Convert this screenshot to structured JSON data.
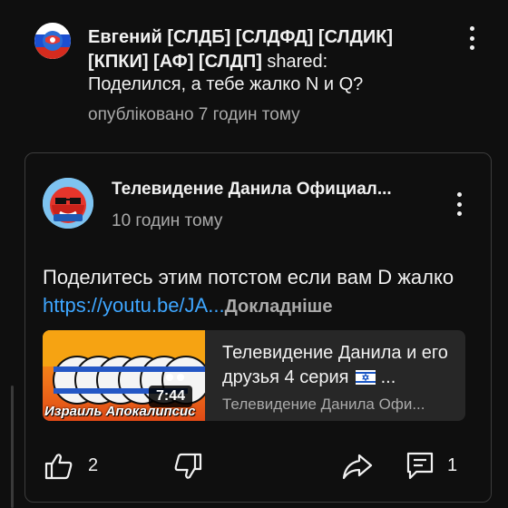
{
  "shared_post": {
    "author": "Евгений [СЛДБ] [СЛДФД] [СЛДИК] [КПКИ] [АФ] [СЛДП]",
    "verb": "shared:",
    "text": "Поделился, а тебе жалко N и Q?",
    "timestamp": "опубліковано 7 годин тому"
  },
  "original_post": {
    "author": "Телевидение Данила Официал...",
    "timestamp": "10 годин тому",
    "text_prefix": "Поделитесь этим потстом если вам D жалко ",
    "link": "https://youtu.be/JA...",
    "more_label": "Докладніше"
  },
  "video": {
    "title": "Телевидение Данила и его друзья 4 серия",
    "title_suffix": "...",
    "channel": "Телевидение Данила Офи...",
    "duration": "7:44",
    "thumbnail_caption": "Израиль Апокалипсис"
  },
  "actions": {
    "like_count": "2",
    "comment_count": "1"
  },
  "icons": {
    "menu": "more-vert-icon",
    "like": "thumb-up-icon",
    "dislike": "thumb-down-icon",
    "share": "share-arrow-icon",
    "comment": "comment-icon"
  },
  "colors": {
    "background": "#0f0f0f",
    "link": "#3ea6ff",
    "secondary_text": "#aaaaaa",
    "card_border": "#3c3c3c"
  }
}
